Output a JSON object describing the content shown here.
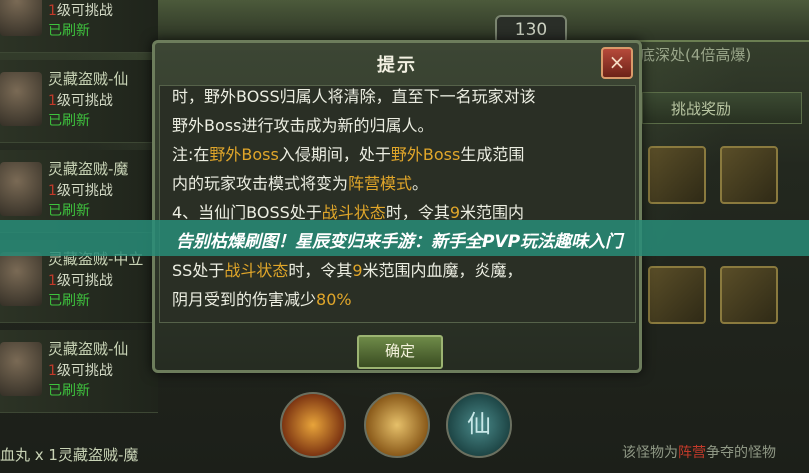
{
  "top": {
    "count": "130"
  },
  "right_panel": {
    "label": "底深处(4倍高爆)",
    "challenge_tab": "挑战奖励"
  },
  "left_list": {
    "items": [
      {
        "name": "",
        "count": "1",
        "sub": "级可挑战",
        "state": "已刷新"
      },
      {
        "name": "灵藏盗贼-仙",
        "count": "1",
        "sub": "级可挑战",
        "state": "已刷新"
      },
      {
        "name": "灵藏盗贼-魔",
        "count": "1",
        "sub": "级可挑战",
        "state": "已刷新"
      },
      {
        "name": "灵藏盗贼-中立",
        "count": "1",
        "sub": "级可挑战",
        "state": "已刷新"
      },
      {
        "name": "灵藏盗贼-仙",
        "count": "1",
        "sub": "级可挑战",
        "state": "已刷新"
      }
    ],
    "bottom_text": "血丸 x 1灵藏盗贼-魔"
  },
  "dialog": {
    "title": "提示",
    "close": "×",
    "confirm": "确定",
    "lines": [
      {
        "a": "时，野外BOSS归属人将清除，直至下一名玩家对该",
        "hl": "",
        "b": ""
      },
      {
        "a": "野外Boss进行攻击成为新的归属人。",
        "hl": "",
        "b": ""
      },
      {
        "a": "注:在",
        "hl": "野外Boss",
        "b": "入侵期间，处于"
      },
      {
        "a": "内的玩家攻击模式将变为",
        "hl": "阵营模式",
        "b": "。"
      },
      {
        "a": "4、当仙门BOSS处于",
        "hl": "战斗状态",
        "b": "时，令其"
      },
      {
        "a": "",
        "hl": "",
        "b": ""
      },
      {
        "a": "SS处于",
        "hl": "战斗状态",
        "b": "时，令其"
      },
      {
        "a": "阴月受到的伤害减少",
        "hl": "80%",
        "b": ""
      }
    ],
    "line3_tail": {
      "hl": "野外Boss",
      "b": "生成范围"
    },
    "line5_tail": {
      "hl": "9",
      "b": "米范围内"
    },
    "line7_tail": {
      "hl": "9",
      "b": "米范围内血魔，炎魔，"
    }
  },
  "banner": {
    "text": "告别枯燥刷图！星辰变归来手游：新手全PVP玩法趣味入门"
  },
  "skills": {
    "xian_label": "仙"
  },
  "bottom_tip": {
    "a": "该怪物为",
    "hl": "阵营",
    "b": "争夺的怪物"
  }
}
